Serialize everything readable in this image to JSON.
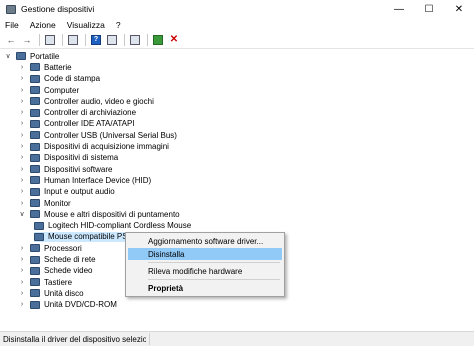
{
  "window": {
    "title": "Gestione dispositivi",
    "minimize": "—",
    "maximize": "☐",
    "close": "✕"
  },
  "menu": [
    "File",
    "Azione",
    "Visualizza",
    "?"
  ],
  "tree": {
    "root": "Portatile",
    "nodes": [
      "Batterie",
      "Code di stampa",
      "Computer",
      "Controller audio, video e giochi",
      "Controller di archiviazione",
      "Controller IDE ATA/ATAPI",
      "Controller USB (Universal Serial Bus)",
      "Dispositivi di acquisizione immagini",
      "Dispositivi di sistema",
      "Dispositivi software",
      "Human Interface Device (HID)",
      "Input e output audio",
      "Monitor",
      "Mouse e altri dispositivi di puntamento",
      "Processori",
      "Schede di rete",
      "Schede video",
      "Tastiere",
      "Unità disco",
      "Unità DVD/CD-ROM"
    ],
    "mouse_children": [
      "Logitech HID-compliant Cordless Mouse",
      "Mouse compatibile PS/2"
    ]
  },
  "context_menu": {
    "update": "Aggiornamento software driver...",
    "uninstall": "Disinstalla",
    "scan": "Rileva modifiche hardware",
    "properties": "Proprietà"
  },
  "status": {
    "text": "Disinstalla il driver del dispositivo selezionato."
  },
  "colors": {
    "selection": "#cce8ff",
    "menu_highlight": "#91c9f7",
    "device_icon": "#4a6f9a"
  }
}
